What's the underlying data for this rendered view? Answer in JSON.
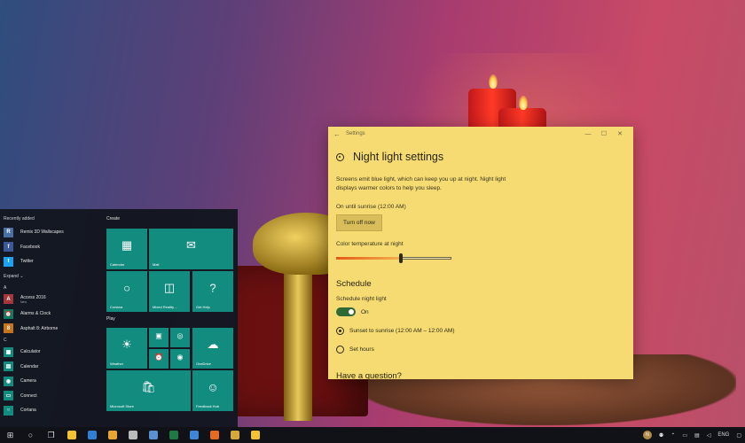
{
  "settings": {
    "window_title": "Settings",
    "back_glyph": "←",
    "min_glyph": "—",
    "max_glyph": "☐",
    "close_glyph": "✕",
    "page_title": "Night light settings",
    "description": "Screens emit blue light, which can keep you up at night. Night light displays warmer colors to help you sleep.",
    "status": "On until sunrise (12:00 AM)",
    "turn_off_button": "Turn off now",
    "color_temp_label": "Color temperature at night",
    "color_temp_level": 0.56,
    "schedule_heading": "Schedule",
    "schedule_label": "Schedule night light",
    "schedule_toggle": "On",
    "radio_sunset": "Sunset to sunrise (12:00 AM – 12:00 AM)",
    "radio_set_hours": "Set hours",
    "help_heading": "Have a question?"
  },
  "start_menu": {
    "recently_added": "Recently added",
    "recent_apps": [
      {
        "label": "Remix 3D Wallscapes",
        "icon": "R",
        "color": "#4a6fa5"
      },
      {
        "label": "Facebook",
        "icon": "f",
        "color": "#3b5998"
      },
      {
        "label": "Twitter",
        "icon": "t",
        "color": "#1da1f2"
      }
    ],
    "expand": "Expand",
    "expand_glyph": "⌄",
    "letter_a": "A",
    "a_apps": [
      {
        "label": "Access 2016",
        "sub": "New",
        "icon": "A",
        "color": "#a4373a"
      },
      {
        "label": "Alarms & Clock",
        "sub": "",
        "icon": "⏰",
        "color": "#0f7a5f"
      },
      {
        "label": "Asphalt 8: Airborne",
        "sub": "",
        "icon": "8",
        "color": "#c8741a"
      }
    ],
    "letter_c": "C",
    "c_apps": [
      {
        "label": "Calculator",
        "icon": "▦",
        "color": "#138c80"
      },
      {
        "label": "Calendar",
        "icon": "▤",
        "color": "#138c80"
      },
      {
        "label": "Camera",
        "icon": "◉",
        "color": "#138c80"
      },
      {
        "label": "Connect",
        "icon": "▭",
        "color": "#138c80"
      },
      {
        "label": "Cortana",
        "icon": "○",
        "color": "#138c80"
      }
    ],
    "create_group": "Create",
    "play_group": "Play",
    "tiles": {
      "calendar": {
        "label": "Calendar",
        "icon": "▦"
      },
      "mail": {
        "label": "Mail",
        "icon": "✉"
      },
      "cortana": {
        "label": "Cortana",
        "icon": "○"
      },
      "mixed_reality": {
        "label": "Mixed Reality ...",
        "icon": "◫"
      },
      "get_help": {
        "label": "Get Help",
        "icon": "?"
      },
      "weather": {
        "label": "Weather",
        "icon": "☀"
      },
      "small_movies": {
        "icon": "▣"
      },
      "small_groove": {
        "icon": "◎"
      },
      "small_alarms": {
        "icon": "⏰"
      },
      "small_camera": {
        "icon": "◉"
      },
      "onedrive": {
        "label": "OneDrive",
        "icon": "☁"
      },
      "microsoft_store": {
        "label": "Microsoft Store",
        "icon": "🛍"
      },
      "feedback_hub": {
        "label": "Feedback Hub",
        "icon": "☺"
      }
    }
  },
  "taskbar": {
    "start_glyph": "⊞",
    "search_glyph": "○",
    "taskview_glyph": "❐",
    "icons": [
      {
        "name": "file-explorer-icon",
        "color": "#f2c233"
      },
      {
        "name": "edge-icon",
        "color": "#2f7fd6"
      },
      {
        "name": "groove-icon",
        "color": "#e8a532"
      },
      {
        "name": "settings-icon",
        "color": "#bbbbbb"
      },
      {
        "name": "photos-icon",
        "color": "#5a8fd0"
      },
      {
        "name": "excel-icon",
        "color": "#1d7a45"
      },
      {
        "name": "store-icon",
        "color": "#3f86d6"
      },
      {
        "name": "firefox-icon",
        "color": "#e66a1f"
      },
      {
        "name": "folder-icon",
        "color": "#d4a93a"
      },
      {
        "name": "store-bag-icon",
        "color": "#f2c233"
      }
    ],
    "tray_avatar": "N",
    "tray_lang": "ENG"
  }
}
